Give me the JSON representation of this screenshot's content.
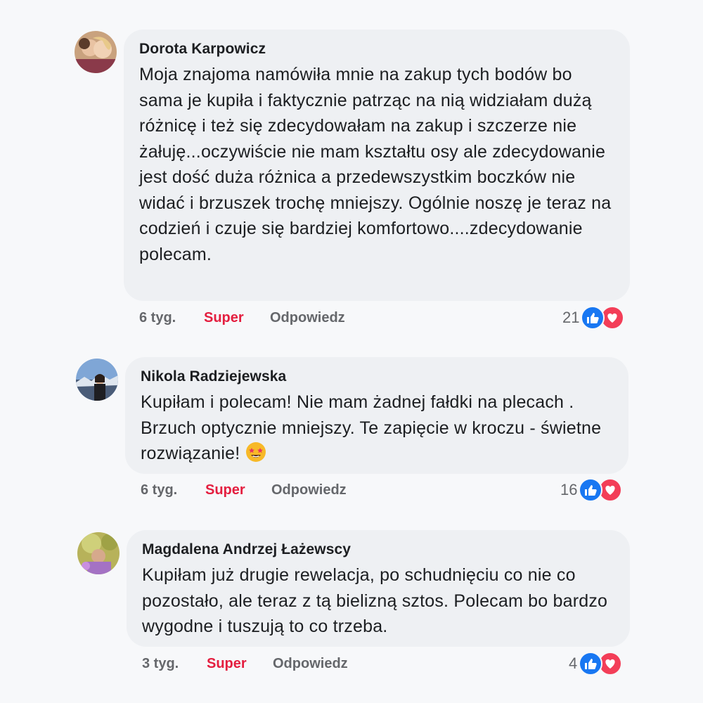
{
  "colors": {
    "background": "#f7f8fa",
    "bubble": "#eef0f3",
    "like_accent": "#e41e3f",
    "meta_grey": "#65676b",
    "like_reaction": "#1877f2",
    "love_reaction": "#f33e58"
  },
  "comments": [
    {
      "author": "Dorota Karpowicz",
      "text": "Moja znajoma namówiła mnie na zakup tych bodów bo sama je kupiła i faktycznie patrząc na nią widziałam dużą różnicę i też się zdecydowałam na zakup i szczerze nie żałuję...oczywiście nie mam kształtu osy ale zdecydowanie jest dość duża różnica a przedewszystkim boczków nie widać i brzuszek trochę mniejszy. Ogólnie noszę je teraz na codzień i czuje się bardziej komfortowo....zdecydowanie polecam.",
      "time": "6 tyg.",
      "like_label": "Super",
      "reply_label": "Odpowiedz",
      "reaction_count": "21",
      "reaction_icons": [
        "like-icon",
        "love-icon"
      ]
    },
    {
      "author": "Nikola Radziejewska",
      "text": "Kupiłam i polecam! Nie mam żadnej fałdki na plecach . Brzuch optycznie mniejszy. Te zapięcie w kroczu - świetne rozwiązanie!",
      "emoji": "star-struck-emoji",
      "time": "6 tyg.",
      "like_label": "Super",
      "reply_label": "Odpowiedz",
      "reaction_count": "16",
      "reaction_icons": [
        "like-icon",
        "love-icon"
      ]
    },
    {
      "author": "Magdalena Andrzej Łażewscy",
      "text": "Kupiłam już drugie rewelacja, po schudnięciu co nie co pozostało, ale teraz z tą bielizną sztos. Polecam bo bardzo wygodne i tuszują to co trzeba.",
      "time": "3 tyg.",
      "like_label": "Super",
      "reply_label": "Odpowiedz",
      "reaction_count": "4",
      "reaction_icons": [
        "like-icon",
        "love-icon"
      ]
    }
  ]
}
